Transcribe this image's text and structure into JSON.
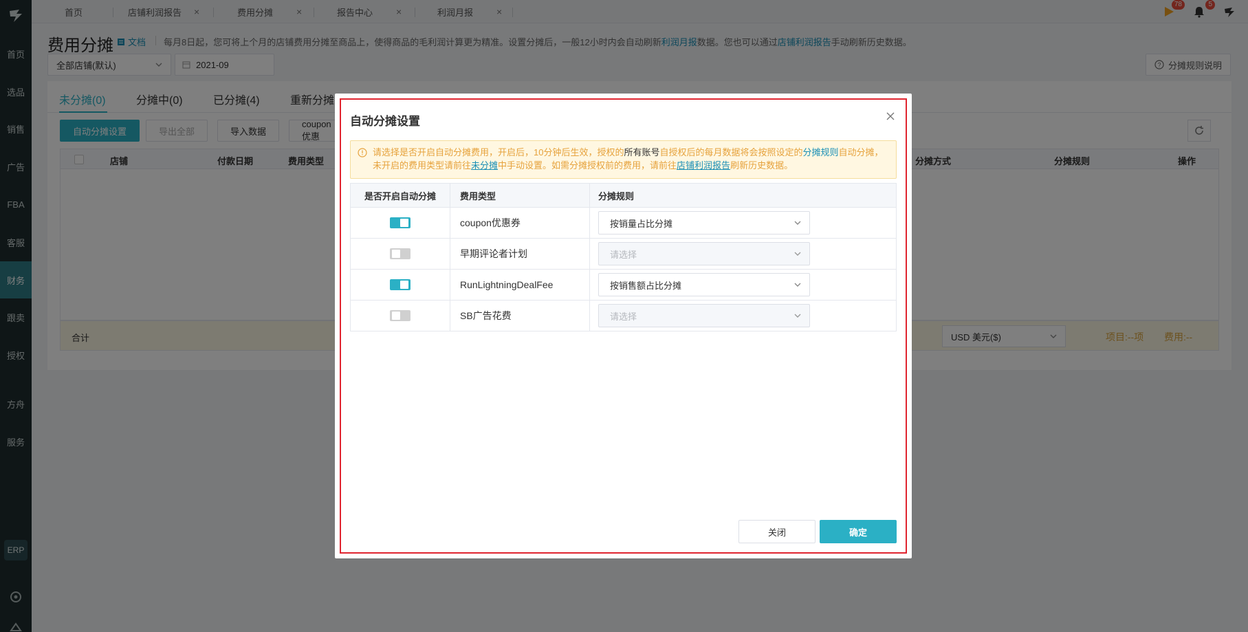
{
  "sidebar": {
    "items": [
      {
        "label": "首页"
      },
      {
        "label": "选品"
      },
      {
        "label": "销售"
      },
      {
        "label": "广告"
      },
      {
        "label": "FBA"
      },
      {
        "label": "客服"
      },
      {
        "label": "财务"
      },
      {
        "label": "跟卖"
      },
      {
        "label": "授权"
      },
      {
        "label": "方舟"
      },
      {
        "label": "服务"
      }
    ],
    "erp_label": "ERP"
  },
  "topbar": {
    "tabs": [
      {
        "label": "首页"
      },
      {
        "label": "店铺利润报告"
      },
      {
        "label": "费用分摊"
      },
      {
        "label": "报告中心"
      },
      {
        "label": "利润月报"
      }
    ],
    "close_glyph": "×",
    "flag_badge": "78",
    "bell_badge": "5"
  },
  "header": {
    "title": "费用分摊",
    "doc_label": "文档",
    "notice_part1": "每月8日起，您可将上个月的店铺费用分摊至商品上，使得商品的毛利润计算更为精准。设置分摊后，一般12小时内会自动刷新",
    "notice_link1": "利润月报",
    "notice_part2": "数据。您也可以通过",
    "notice_link2": "店铺利润报告",
    "notice_part3": "手动刷新历史数据。",
    "store_select": "全部店铺(默认)",
    "month_value": "2021-09",
    "rules_button": "分摊规则说明"
  },
  "main": {
    "status_tabs": [
      {
        "label": "未分摊(0)"
      },
      {
        "label": "分摊中(0)"
      },
      {
        "label": "已分摊(4)"
      },
      {
        "label": "重新分摊"
      }
    ],
    "buttons": {
      "auto": "自动分摊设置",
      "export": "导出全部",
      "import": "导入数据",
      "coupon": "coupon优惠"
    },
    "columns": {
      "store": "店铺",
      "pay_date": "付款日期",
      "fee_type": "费用类型",
      "method": "分摊方式",
      "rule": "分摊规则",
      "action": "操作"
    },
    "total_label": "合计",
    "currency": "USD  美元($)",
    "total_items": "项目:--项",
    "total_cost": "费用:--"
  },
  "modal": {
    "title": "自动分摊设置",
    "alert": {
      "t1": "请选择是否开启自动分摊费用，开启后，10分钟后生效，授权的",
      "t2": "所有账号",
      "t3": "自授权后的每月数据将会按照设定的",
      "t4": "分摊规则",
      "t5": "自动分摊，未开启的费用类型请前往",
      "t6": "未分摊",
      "t7": "中手动设置。如需分摊授权前的费用，请前往",
      "t8": "店铺利润报告",
      "t9": "刷新历史数据。"
    },
    "headers": {
      "enabled": "是否开启自动分摊",
      "fee_type": "费用类型",
      "rule": "分摊规则"
    },
    "rows": [
      {
        "enabled": true,
        "fee_type": "coupon优惠券",
        "rule": "按销量占比分摊"
      },
      {
        "enabled": false,
        "fee_type": "早期评论者计划",
        "rule": "请选择"
      },
      {
        "enabled": true,
        "fee_type": "RunLightningDealFee",
        "rule": "按销售额占比分摊"
      },
      {
        "enabled": false,
        "fee_type": "SB广告花费",
        "rule": "请选择"
      }
    ],
    "close_button": "关闭",
    "ok_button": "确定"
  },
  "colors": {
    "accent": "#2bb0c5",
    "sidebar_bg": "#1f2d2e",
    "warning_text": "#e6a23c",
    "highlight_frame": "#e0242f"
  }
}
